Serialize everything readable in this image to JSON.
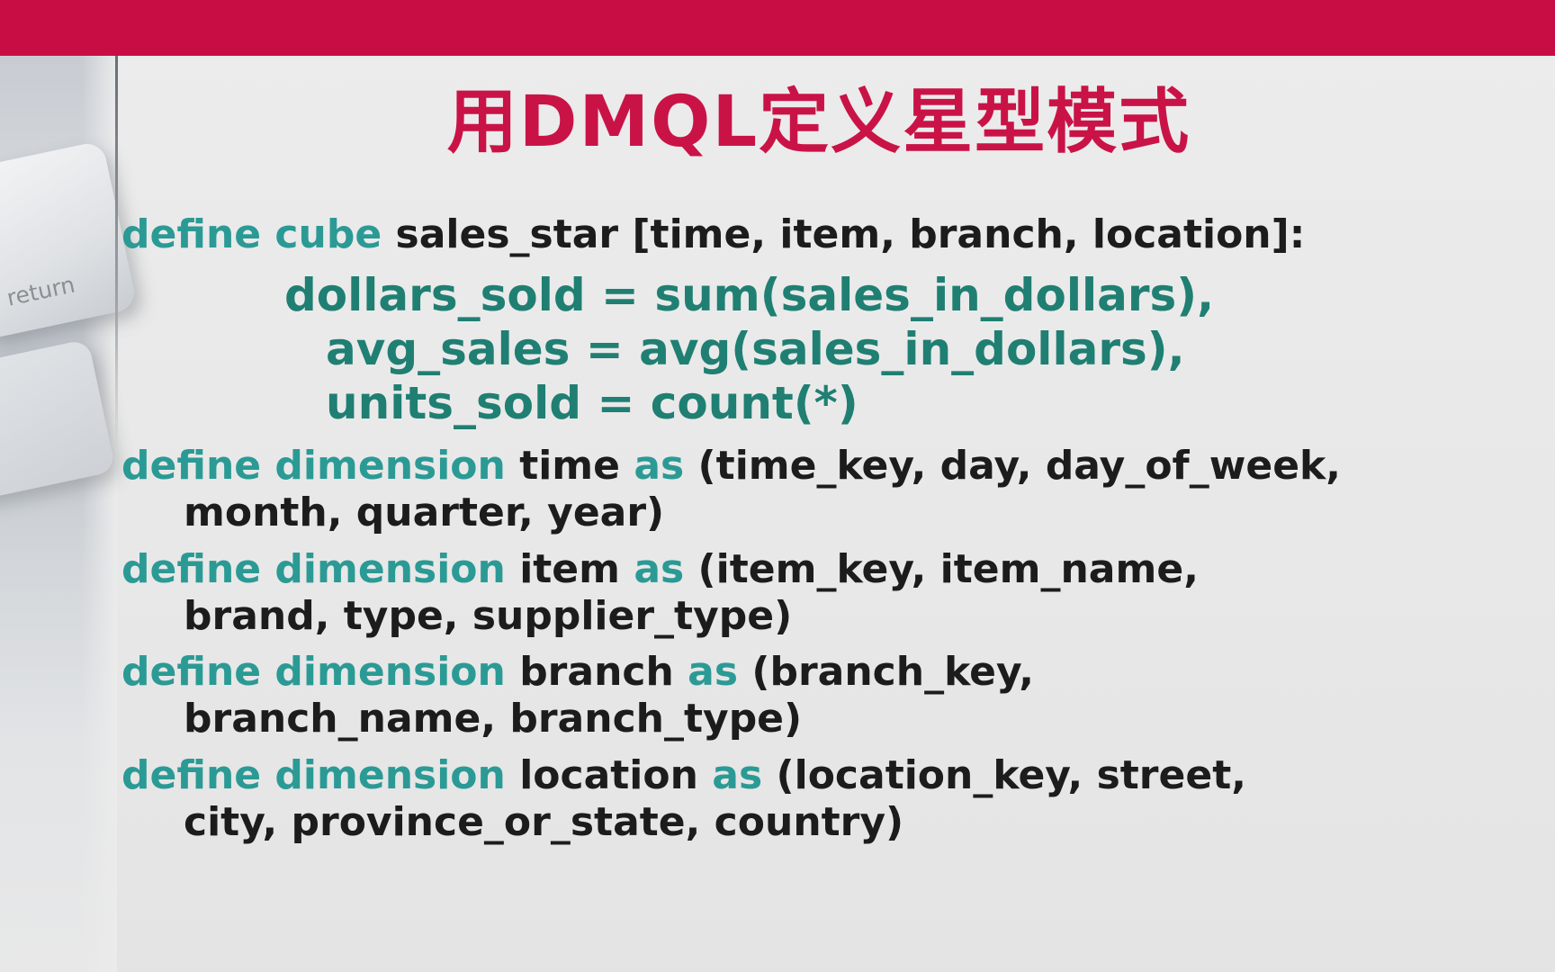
{
  "title": "用DMQL定义星型模式",
  "sidebar": {
    "decoration_label": "return"
  },
  "cube": {
    "keyword": "define cube",
    "header": "sales_star [time, item, branch, location]:",
    "measures": [
      "dollars_sold = sum(sales_in_dollars),",
      "avg_sales = avg(sales_in_dollars),",
      "units_sold = count(*)"
    ]
  },
  "dimensions": [
    {
      "keyword": "define dimension",
      "name": "time",
      "as": "as",
      "line1": "(time_key, day, day_of_week,",
      "line2": "month, quarter, year)"
    },
    {
      "keyword": "define dimension",
      "name": "item",
      "as": "as",
      "line1": "(item_key, item_name,",
      "line2": "brand, type, supplier_type)"
    },
    {
      "keyword": "define dimension",
      "name": "branch",
      "as": "as",
      "line1": "(branch_key,",
      "line2": "branch_name, branch_type)"
    },
    {
      "keyword": "define dimension",
      "name": "location",
      "as": "as",
      "line1": "(location_key, street,",
      "line2": "city, province_or_state, country)"
    }
  ],
  "colors": {
    "top_bar": "#c80d45",
    "title": "#c91347",
    "keyword": "#2b9a95",
    "measure": "#1f7f72",
    "text": "#1c1c1c"
  }
}
